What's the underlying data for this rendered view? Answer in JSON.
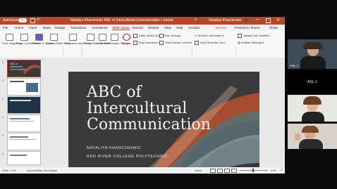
{
  "titlebar": {
    "autosave": "AutoSave",
    "autosave_state": "On",
    "doc_title": "Nataliya Kharchenko ABC of Intercultural Communication • Saved",
    "user": "Nataliya Kharchenko",
    "accent": "#b7472a"
  },
  "tabs": [
    "File",
    "Home",
    "Insert",
    "Draw",
    "Design",
    "Transitions",
    "Animations",
    "Slide Show",
    "Record",
    "Review",
    "View",
    "Help",
    "Acrobat"
  ],
  "active_tab": "Slide Show",
  "top_right": {
    "record": "Record",
    "present_teams": "Present in Teams",
    "share": "Share"
  },
  "ribbon": {
    "from_beginning": "From Beginning",
    "from_current": "From Current Slide",
    "present_teams": "Present in Teams",
    "custom_show": "Custom Slide Show",
    "rehearse": "Rehearse with Coach",
    "setup": "Set Up Slide Show",
    "hide": "Hide Slide",
    "rehearse_timings": "Rehearse Timings",
    "record": "Record",
    "keep_updated": "Keep Slides Updated",
    "play_narrations": "Play Narrations",
    "use_timings": "Use Timings",
    "show_media": "Show Media Controls",
    "monitor_label": "Monitor:",
    "monitor_value": "Automatic",
    "presenter_view": "Use Presenter View",
    "always_subtitles": "Always Use Subtitles",
    "subtitle_settings": "Subtitle Settings",
    "groups": {
      "start": "Start Slide Show",
      "rehearse": "Rehearse",
      "setup": "Set Up",
      "monitors": "Monitors",
      "captions": "Captions & Subtitles"
    }
  },
  "thumbnails": [
    {
      "num": "1",
      "title": "ABC of Intercultural Communication"
    },
    {
      "num": "2",
      "title": ""
    },
    {
      "num": "3",
      "title": ""
    },
    {
      "num": "4",
      "title": ""
    },
    {
      "num": "5",
      "title": ""
    },
    {
      "num": "6",
      "title": ""
    }
  ],
  "slide": {
    "title_line1": "ABC of",
    "title_line2": "Intercultural",
    "title_line3": "Communication",
    "author": "NATALIYA KHARCHENKO",
    "org": "RED RIVER COLLEGE POLYTECHNIC"
  },
  "statusbar": {
    "slide_count": "Slide 1 of 8",
    "accessibility": "Accessibility: Investigate",
    "notes": "Notes",
    "zoom": "47%"
  },
  "participants": [
    {
      "label": "ASL 1"
    },
    {
      "label": "ASL 1"
    },
    {
      "label": ""
    },
    {
      "label": ""
    }
  ]
}
